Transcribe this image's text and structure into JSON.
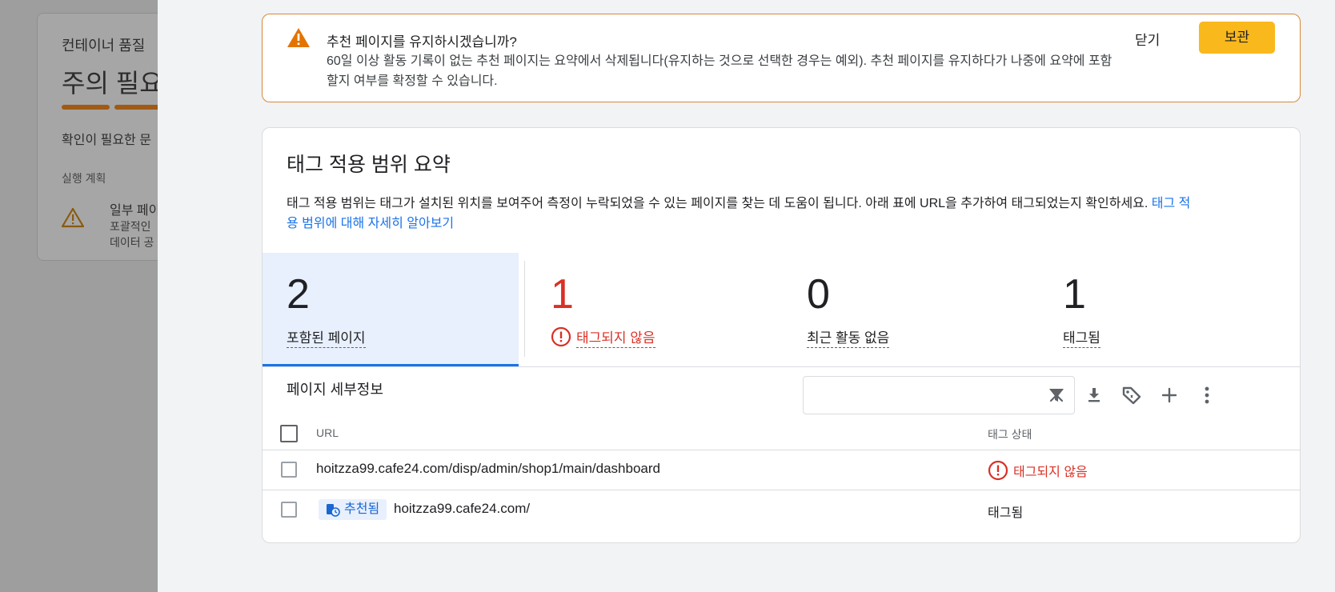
{
  "background": {
    "card_title": "컨테이너 품질",
    "status_heading": "주의 필요",
    "subtitle": "확인이 필요한 문",
    "section_label": "실행 계획",
    "item_title": "일부 페이",
    "item_desc_1": "포괄적인",
    "item_desc_2": "데이터 공",
    "bar_color": "#a05a14"
  },
  "banner": {
    "title": "추천 페이지를 유지하시겠습니까?",
    "body": "60일 이상 활동 기록이 없는 추천 페이지는 요약에서 삭제됩니다(유지하는 것으로 선택한 경우는 예외). 추천 페이지를 유지하다가 나중에 요약에 포함할지 여부를 확정할 수 있습니다.",
    "close_label": "닫기",
    "keep_label": "보관",
    "icon": "warning-icon",
    "accent_color": "#d8893a"
  },
  "coverage": {
    "title": "태그 적용 범위 요약",
    "description": "태그 적용 범위는 태그가 설치된 위치를 보여주어 측정이 누락되었을 수 있는 페이지를 찾는 데 도움이 됩니다. 아래 표에 URL을 추가하여 태그되었는지 확인하세요.",
    "learn_more_link": "태그 적용 범위에 대해 자세히 알아보기",
    "stats": [
      {
        "value": "2",
        "label": "포함된 페이지",
        "selected": true
      },
      {
        "value": "1",
        "label": "태그되지 않음",
        "color": "#d93025",
        "icon": "error-icon"
      },
      {
        "value": "0",
        "label": "최근 활동 없음"
      },
      {
        "value": "1",
        "label": "태그됨"
      }
    ]
  },
  "page_details": {
    "title": "페이지 세부정보",
    "search_value": "",
    "search_placeholder": "",
    "toolbar_icons": [
      "filter-icon",
      "download-icon",
      "tag-icon",
      "add-icon",
      "more-vert-icon"
    ],
    "columns": {
      "url": "URL",
      "status": "태그 상태"
    },
    "rows": [
      {
        "url": "hoitzza99.cafe24.com/disp/admin/shop1/main/dashboard",
        "status": "태그되지 않음",
        "status_type": "error"
      },
      {
        "url": "hoitzza99.cafe24.com/",
        "badge": "추천됨",
        "status": "태그됨",
        "status_type": "ok"
      }
    ]
  }
}
